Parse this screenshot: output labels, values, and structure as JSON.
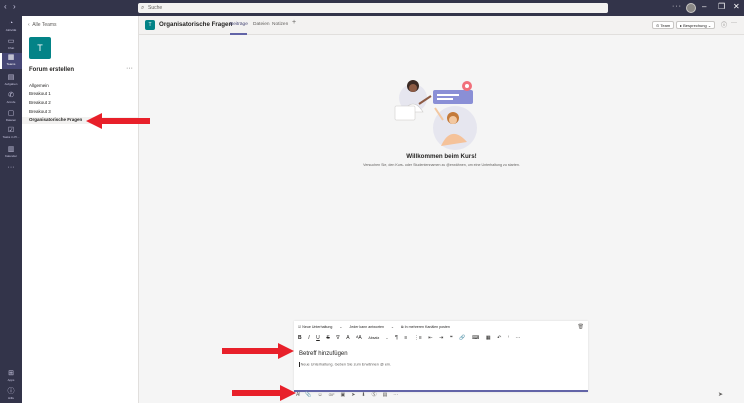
{
  "titlebar": {
    "back_icon": "‹",
    "forward_icon": "›",
    "search_placeholder": "Suche",
    "more_icon": "···",
    "window_controls": [
      "–",
      "❐",
      "✕"
    ]
  },
  "rail": {
    "items": [
      {
        "label": "Aktivität",
        "icon": "bell-icon",
        "glyph": "🔔"
      },
      {
        "label": "Chat",
        "icon": "chat-icon",
        "glyph": "💬"
      },
      {
        "label": "Teams",
        "icon": "teams-icon",
        "glyph": "👥"
      },
      {
        "label": "Aufgaben",
        "icon": "assignments-icon",
        "glyph": "🎒"
      },
      {
        "label": "Anrufe",
        "icon": "phone-icon",
        "glyph": "📞"
      },
      {
        "label": "Dateien",
        "icon": "files-icon",
        "glyph": "📁"
      },
      {
        "label": "Tasks in Pl...",
        "icon": "planner-icon",
        "glyph": "☑"
      },
      {
        "label": "Kalender",
        "icon": "calendar-icon",
        "glyph": "📅"
      }
    ],
    "more": "···",
    "bottom": [
      {
        "label": "Apps",
        "icon": "apps-icon",
        "glyph": "⊞"
      },
      {
        "label": "Hilfe",
        "icon": "help-icon",
        "glyph": "?"
      }
    ]
  },
  "channel_pane": {
    "back_label": "Alle Teams",
    "team_initial": "T",
    "team_name": "Forum erstellen",
    "more": "···",
    "channels": [
      "Allgemein",
      "Breakout 1",
      "Breakout 2",
      "Breakout 3",
      "Organisatorische Fragen"
    ],
    "selected_channel": "Organisatorische Fragen"
  },
  "header": {
    "channel_initial": "T",
    "channel_title": "Organisatorische Fragen",
    "tabs": [
      "Beiträge",
      "Dateien",
      "Notizen"
    ],
    "active_tab": "Beiträge",
    "add_tab": "+",
    "team_button": "Team",
    "meeting_button": "Besprechung",
    "info_icon": "ⓘ",
    "more": "···"
  },
  "welcome": {
    "title": "Willkommen beim Kurs!",
    "subtitle": "Versuchen Sie, den Kurs- oder Studentennamen zu @erwähnen, um eine Unterhaltung zu starten."
  },
  "compose": {
    "type_label": "Neue Unterhaltung",
    "reply_label": "Jeder kann antworten",
    "multi_channel_label": "In mehreren Kanälen posten",
    "paragraph_label": "Absatz",
    "subject_placeholder": "Betreff hinzufügen",
    "body_placeholder": "Neue Unterhaltung. Geben Sie zum Erwähnen @ ein.",
    "format_buttons": [
      "B",
      "I",
      "U",
      "S",
      "∇",
      "A",
      "ᴬA",
      "¶",
      "≡",
      "⋮≡",
      "⇤",
      "⇥",
      "❝",
      "🔗",
      "⌨",
      "▦",
      "↶",
      "ⁱ",
      "···"
    ],
    "toolbar_icons": [
      "A̸",
      "📎",
      "☺",
      "GIF",
      "▣",
      "➤",
      "⬇",
      "Ⓢ",
      "▤",
      "···"
    ],
    "send_icon": "➤",
    "delete_icon": "🗑"
  },
  "colors": {
    "rail": "#33344a",
    "accent": "#6264a7",
    "team_tile": "#038387",
    "arrow": "#e8202a"
  }
}
